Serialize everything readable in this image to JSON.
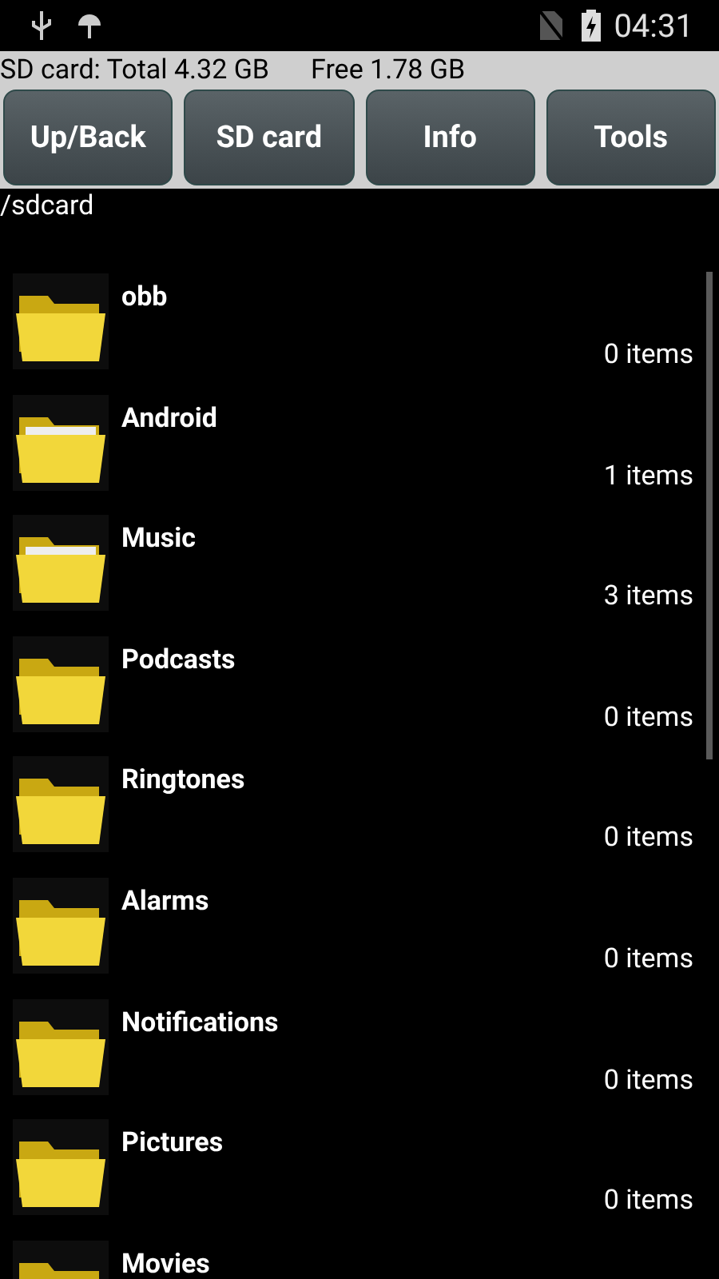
{
  "status_bar": {
    "time": "04:31"
  },
  "storage": {
    "total": "SD card: Total 4.32 GB",
    "free": "Free 1.78 GB"
  },
  "buttons": [
    "Up/Back",
    "SD card",
    "Info",
    "Tools"
  ],
  "path": "/sdcard",
  "folders": [
    {
      "name": "obb",
      "count": "0 items",
      "has_files": false
    },
    {
      "name": "Android",
      "count": "1 items",
      "has_files": true
    },
    {
      "name": "Music",
      "count": "3 items",
      "has_files": true
    },
    {
      "name": "Podcasts",
      "count": "0 items",
      "has_files": false
    },
    {
      "name": "Ringtones",
      "count": "0 items",
      "has_files": false
    },
    {
      "name": "Alarms",
      "count": "0 items",
      "has_files": false
    },
    {
      "name": "Notifications",
      "count": "0 items",
      "has_files": false
    },
    {
      "name": "Pictures",
      "count": "0 items",
      "has_files": false
    },
    {
      "name": "Movies",
      "has_files": false
    }
  ]
}
